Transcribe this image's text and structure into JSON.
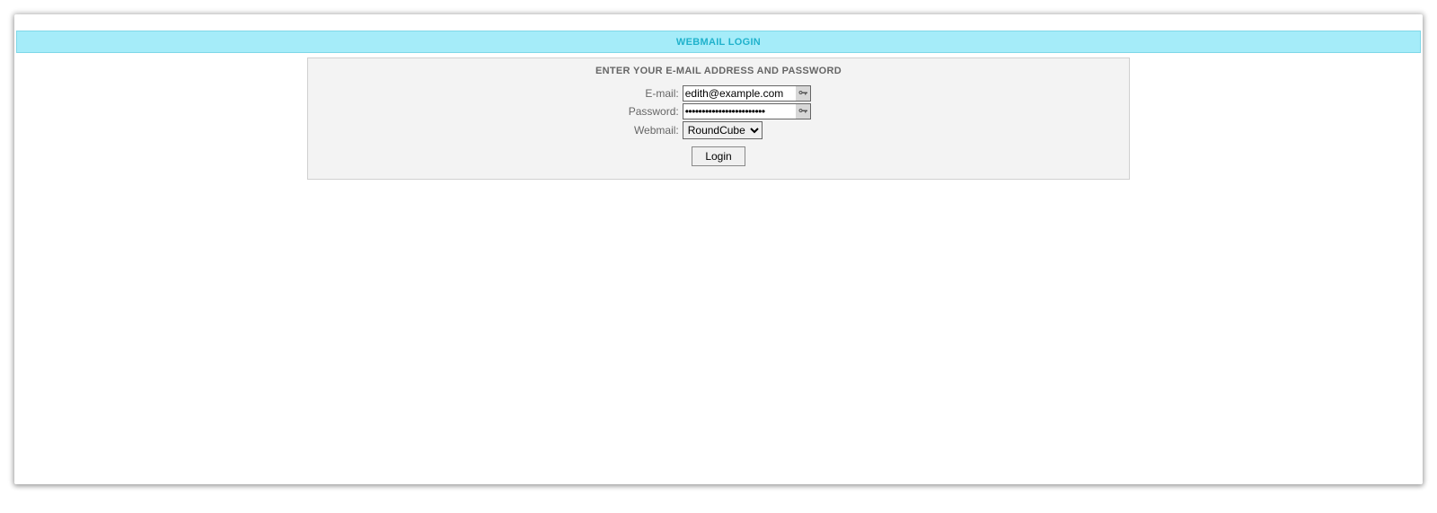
{
  "header": {
    "title": "WEBMAIL LOGIN"
  },
  "panel": {
    "heading": "ENTER YOUR E-MAIL ADDRESS AND PASSWORD"
  },
  "form": {
    "email_label": "E-mail:",
    "email_value": "edith@example.com",
    "password_label": "Password:",
    "password_value": "••••••••••••••••••••••••",
    "webmail_label": "Webmail:",
    "webmail_selected": "RoundCube",
    "login_button": "Login"
  }
}
